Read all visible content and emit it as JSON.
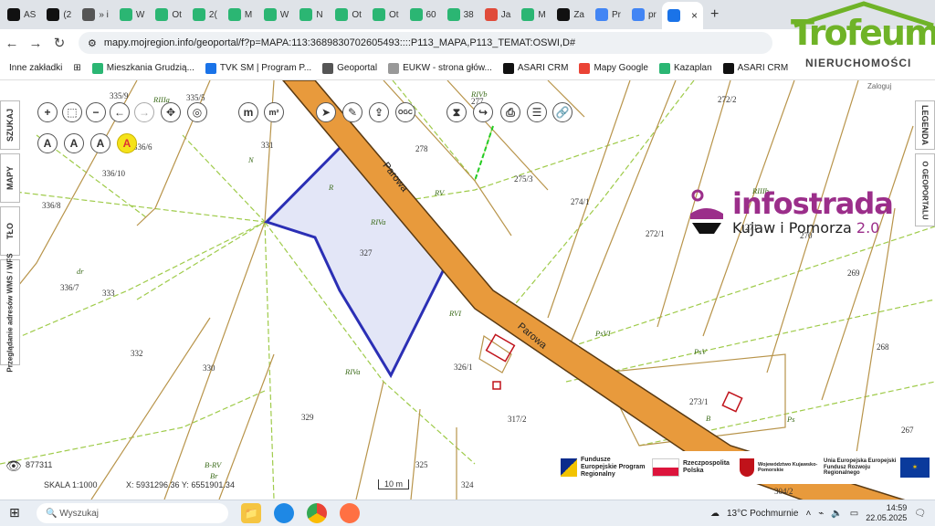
{
  "browser": {
    "tabs": [
      {
        "label": "AS",
        "color": "#111"
      },
      {
        "label": "(2",
        "color": "#111"
      },
      {
        "label": "» i",
        "color": "#555"
      },
      {
        "label": "W",
        "color": "#2bb673"
      },
      {
        "label": "Ot",
        "color": "#2bb673"
      },
      {
        "label": "2(",
        "color": "#2bb673"
      },
      {
        "label": "M",
        "color": "#2bb673"
      },
      {
        "label": "W",
        "color": "#2bb673"
      },
      {
        "label": "N",
        "color": "#2bb673"
      },
      {
        "label": "Ot",
        "color": "#2bb673"
      },
      {
        "label": "Ot",
        "color": "#2bb673"
      },
      {
        "label": "60",
        "color": "#2bb673"
      },
      {
        "label": "38",
        "color": "#2bb673"
      },
      {
        "label": "Ja",
        "color": "#e04b3a"
      },
      {
        "label": "M",
        "color": "#2bb673"
      },
      {
        "label": "Za",
        "color": "#111"
      },
      {
        "label": "Pr",
        "color": "#4285f4"
      },
      {
        "label": "pr",
        "color": "#4285f4"
      },
      {
        "label": "",
        "color": "#1a73e8",
        "active": true
      }
    ],
    "url": "mapy.mojregion.info/geoportal/f?p=MAPA:113:3689830702605493::::P113_MAPA,P113_TEMAT:OSWI,D#",
    "bookmarks": [
      {
        "label": "Inne zakładki"
      },
      {
        "label": "Mieszkania Grudzią..."
      },
      {
        "label": "TVK SM | Program P..."
      },
      {
        "label": "Geoportal"
      },
      {
        "label": "EUKW - strona głów..."
      },
      {
        "label": "ASARI CRM"
      },
      {
        "label": "Mapy Google"
      },
      {
        "label": "Kazaplan"
      },
      {
        "label": "ASARI CRM"
      }
    ]
  },
  "map": {
    "plot_numbers": [
      "335/9",
      "335/5",
      "331",
      "278",
      "277",
      "272/2",
      "275/3",
      "274/1",
      "336/6",
      "336/10",
      "336/8",
      "271",
      "272/1",
      "270",
      "269",
      "327",
      "336/7",
      "333",
      "332",
      "330",
      "326/1",
      "268",
      "273/1",
      "317/2",
      "267",
      "329",
      "325",
      "324",
      "304/2"
    ],
    "land_classes": [
      "RIIIa",
      "RIVb",
      "RIVa",
      "RV",
      "RVI",
      "N",
      "R",
      "PsVI",
      "PsV",
      "B",
      "dr",
      "B-RV",
      "Br",
      "Ps",
      "RIVa",
      "RIIIb"
    ],
    "street": "Parowa",
    "status": {
      "scale": "SKALA 1:1000",
      "coords": "X: 5931296.36  Y: 6551901.34",
      "count": "877311",
      "scale_bar": "10 m",
      "login": "Zaloguj"
    },
    "side_tabs": [
      "SZUKAJ",
      "MAPY",
      "TŁO",
      "Przeglądanie adresów WMS / WFS",
      "LEGENDA",
      "O GEOPORTALU"
    ],
    "tool_labels": [
      "m",
      "m²",
      "OGC"
    ]
  },
  "branding": {
    "infostrada_title": "infostrada",
    "infostrada_sub": "Kujaw i Pomorza",
    "infostrada_ver": "2.0",
    "trofeum_word": "Trofeum",
    "trofeum_sub": "NIERUCHOMOŚCI",
    "eu": [
      "Fundusze Europejskie Program Regionalny",
      "Rzeczpospolita Polska",
      "Województwo Kujawsko-Pomorskie",
      "Unia Europejska Europejski Fundusz Rozwoju Regionalnego"
    ]
  },
  "taskbar": {
    "search_placeholder": "Wyszukaj",
    "weather": "13°C  Pochmurnie",
    "time": "14:59",
    "date": "22.05.2025"
  },
  "colors": {
    "road": "#e89a3c",
    "road_edge": "#5a3a12",
    "selected_fill": "#e3e6f7",
    "selected_stroke": "#2b2fb5",
    "parcel_line": "#b8944a",
    "landuse_line": "#9fcb4a"
  }
}
